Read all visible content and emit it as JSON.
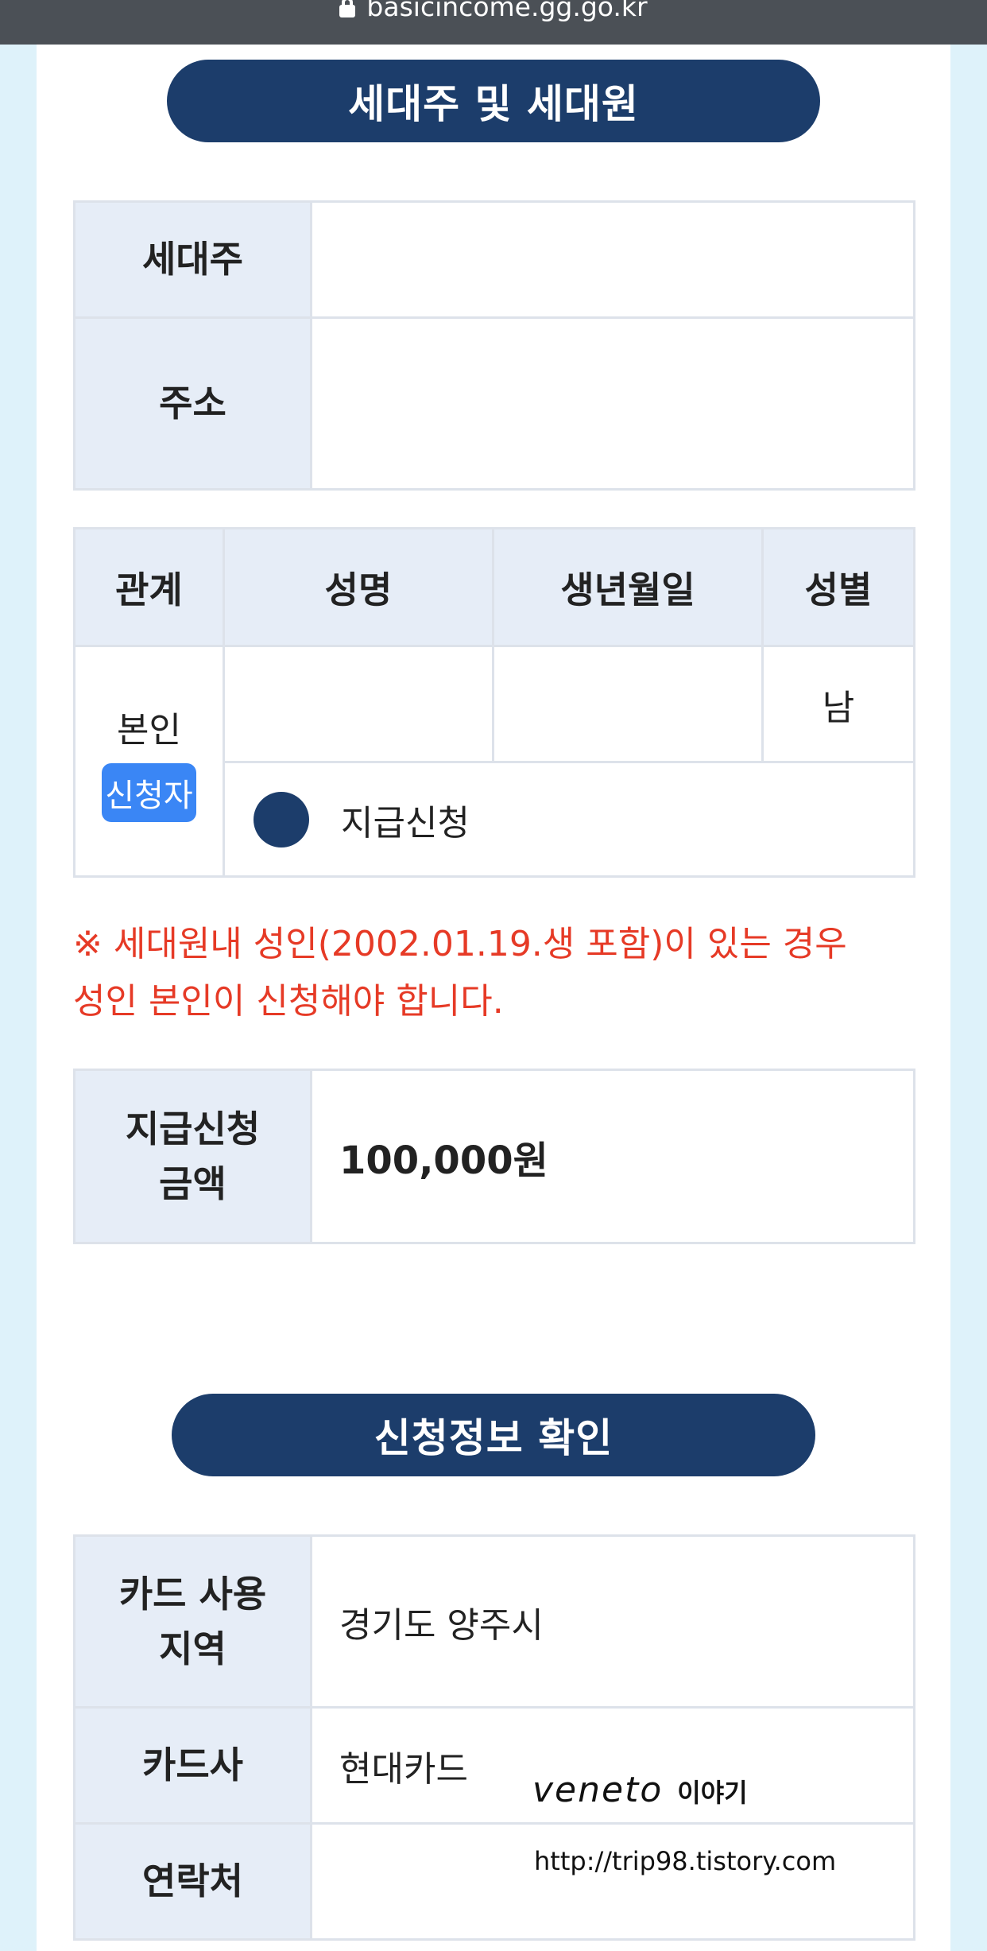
{
  "browser": {
    "url": "basicincome.gg.go.kr"
  },
  "household": {
    "section_title": "세대주 및 세대원",
    "head_label": "세대주",
    "head_value": "",
    "address_label": "주소",
    "address_value": ""
  },
  "members": {
    "headers": [
      "관계",
      "성명",
      "생년월일",
      "성별"
    ],
    "row": {
      "relation": "본인",
      "badge": "신청자",
      "name": "",
      "birth": "",
      "gender": "남",
      "radio_label": "지급신청"
    }
  },
  "notice": {
    "line1": "※ 세대원내 성인(2002.01.19.생 포함)이 있는 경우",
    "line2": "성인 본인이 신청해야 합니다."
  },
  "amount": {
    "label_line1": "지급신청",
    "label_line2": "금액",
    "value": "100,000원"
  },
  "confirm": {
    "section_title": "신청정보 확인",
    "region_label_line1": "카드 사용",
    "region_label_line2": "지역",
    "region_value": "경기도 양주시",
    "card_label": "카드사",
    "card_value": "현대카드",
    "contact_label": "연락처",
    "contact_value": ""
  },
  "watermark": {
    "brand": "veneto",
    "brand_suffix": "이야기",
    "url": "http://trip98.tistory.com"
  },
  "colors": {
    "navy": "#1c3d6b",
    "label_bg": "#e6edf7",
    "badge_blue": "#3a86f5",
    "notice_red": "#e63a26",
    "page_bg": "#def2fa"
  }
}
